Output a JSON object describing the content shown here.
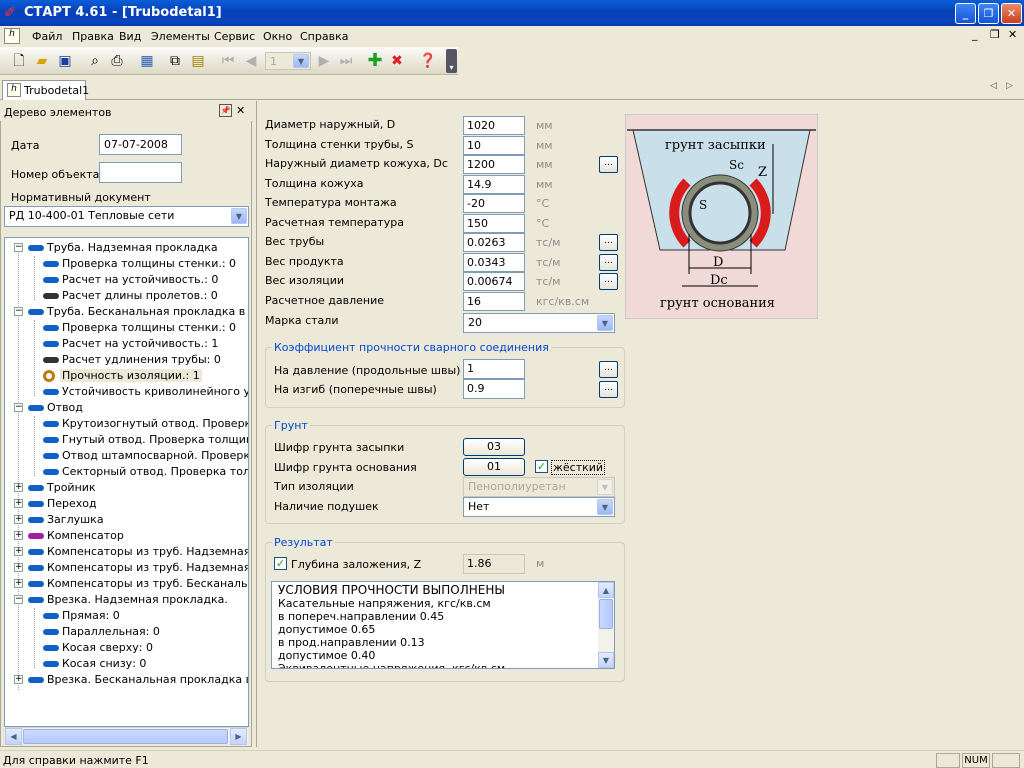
{
  "window": {
    "title": "СТАРТ 4.61 - [Trubodetal1]"
  },
  "menu": [
    "Файл",
    "Правка",
    "Вид",
    "Элементы",
    "Сервис",
    "Окно",
    "Справка"
  ],
  "toolbar": {
    "page_value": "1"
  },
  "doc_tab": "Trubodetal1",
  "panel": {
    "title": "Дерево элементов",
    "date_label": "Дата",
    "date_value": "07-07-2008",
    "object_label": "Номер объекта",
    "object_value": "",
    "norm_label": "Нормативный документ",
    "norm_value": "РД 10-400-01 Тепловые сети"
  },
  "tree": [
    "Труба. Надземная прокладка",
    "Проверка толщины стенки.: 0",
    "Расчет на устойчивость.: 0",
    "Расчет длины пролетов.: 0",
    "Труба. Бесканальная прокладка в тра",
    "Проверка толщины стенки.: 0",
    "Расчет на устойчивость.: 1",
    "Расчет удлинения трубы: 0",
    "Прочность изоляции.: 1",
    "Устойчивость криволинейного уча",
    "Отвод",
    "Крутоизогнутый отвод. Проверка",
    "Гнутый отвод. Проверка толщины",
    "Отвод штампосварной. Проверка т",
    "Секторный отвод. Проверка толщ",
    "Тройник",
    "Переход",
    "Заглушка",
    "Компенсатор",
    "Компенсаторы из труб. Надземная про",
    "Компенсаторы из труб. Надземная про",
    "Компенсаторы из труб. Бесканальная",
    "Врезка. Надземная прокладка.",
    "Прямая: 0",
    "Параллельная: 0",
    "Косая сверху: 0",
    "Косая снизу: 0",
    "Врезка. Бесканальная прокладка в тра"
  ],
  "params": [
    {
      "label": "Диаметр наружный, D",
      "value": "1020",
      "unit": "мм"
    },
    {
      "label": "Толщина стенки трубы, S",
      "value": "10",
      "unit": "мм"
    },
    {
      "label": "Наружный диаметр кожуха, Dc",
      "value": "1200",
      "unit": "мм"
    },
    {
      "label": "Толщина кожуха",
      "value": "14.9",
      "unit": "мм"
    },
    {
      "label": "Температура монтажа",
      "value": "-20",
      "unit": "°C"
    },
    {
      "label": "Расчетная температура",
      "value": "150",
      "unit": "°C"
    },
    {
      "label": "Вес трубы",
      "value": "0.0263",
      "unit": "тс/м"
    },
    {
      "label": "Вес продукта",
      "value": "0.0343",
      "unit": "тс/м"
    },
    {
      "label": "Вес изоляции",
      "value": "0.00674",
      "unit": "тс/м"
    },
    {
      "label": "Расчетное давление",
      "value": "16",
      "unit": "кгс/кв.см"
    }
  ],
  "steel": {
    "label": "Марка стали",
    "value": "20"
  },
  "weld": {
    "title": "Коэффициент прочности сварного соединения",
    "pressure_label": "На давление (продольные швы)",
    "pressure_value": "1",
    "bend_label": "На изгиб (поперечные швы)",
    "bend_value": "0.9"
  },
  "soil": {
    "title": "Грунт",
    "fill_label": "Шифр грунта засыпки",
    "fill_value": "03",
    "base_label": "Шифр грунта основания",
    "base_value": "01",
    "hard_label": "жёсткий",
    "insul_label": "Тип изоляции",
    "insul_value": "Пенополиуретан",
    "pads_label": "Наличие подушек",
    "pads_value": "Нет"
  },
  "result": {
    "title": "Результат",
    "depth_label": "Глубина заложения, Z",
    "depth_value": "1.86",
    "depth_unit": "м",
    "lines": [
      "УСЛОВИЯ ПРОЧНОСТИ ВЫПОЛНЕНЫ",
      "Касательные напряжения, кгс/кв.см",
      "в попереч.направлении  0.45",
      "допустимое  0.65",
      "в прод.направлении  0.13",
      "допустимое  0.40",
      "Эквивалентные напряжения, кгс/кв.см"
    ]
  },
  "diagram": {
    "fill_label": "грунт засыпки",
    "base_label": "грунт основания",
    "S": "S",
    "Sc": "Sc",
    "Z": "Z",
    "D": "D",
    "Dc": "Dc"
  },
  "status": {
    "help": "Для справки нажмите F1",
    "num": "NUM"
  }
}
